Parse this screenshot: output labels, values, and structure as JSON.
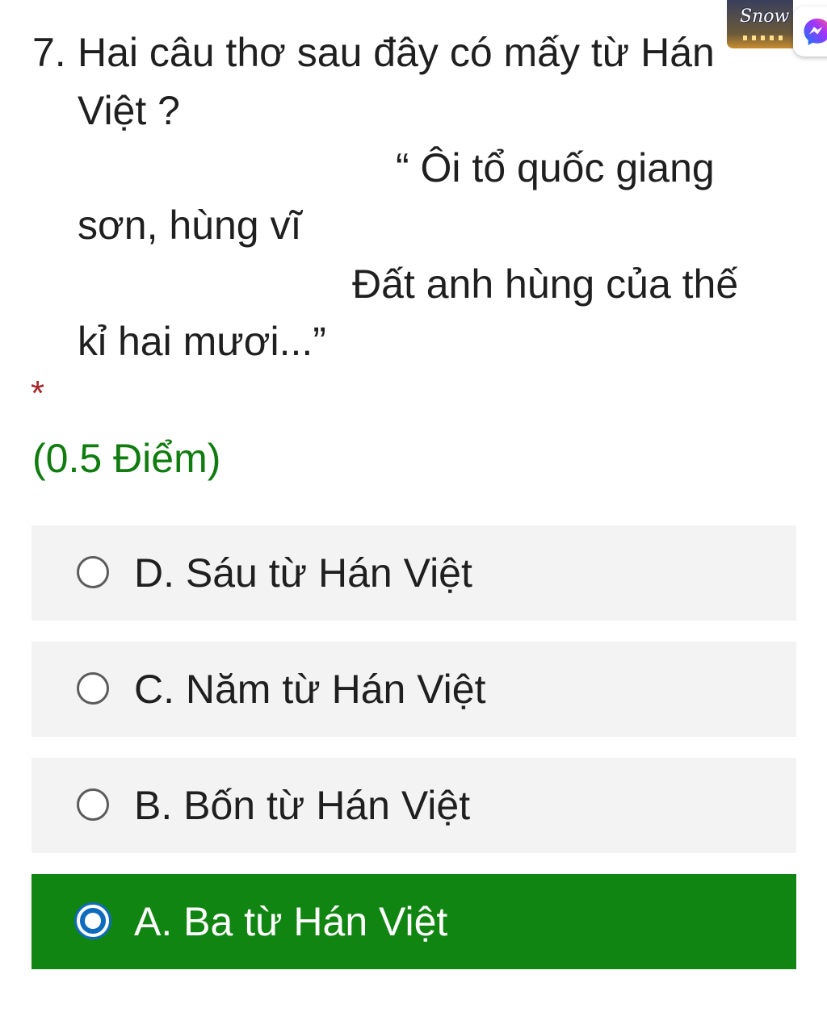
{
  "question": {
    "number": "7.",
    "lines": [
      "Hai câu thơ sau đây có mấy từ Hán",
      "Việt  ?",
      "“ Ôi tổ quốc giang",
      "sơn, hùng vĩ",
      "Đất anh hùng của thế",
      "kỉ hai mươi...”"
    ],
    "required_mark": "*",
    "points": "(0.5 Điểm)"
  },
  "options": [
    {
      "label": "D. Sáu từ Hán Việt",
      "selected": false
    },
    {
      "label": "C. Năm từ Hán Việt",
      "selected": false
    },
    {
      "label": "B. Bốn từ Hán Việt",
      "selected": false
    },
    {
      "label": "A. Ba từ Hán Việt",
      "selected": true
    }
  ],
  "overlay": {
    "badge_text": "Snow",
    "messenger_icon": "messenger-icon"
  },
  "colors": {
    "selected_bg": "#118511",
    "points_text": "#107c10",
    "required": "#a4262c",
    "radio_selected": "#0f6cbd",
    "option_bg": "#f3f3f3"
  }
}
